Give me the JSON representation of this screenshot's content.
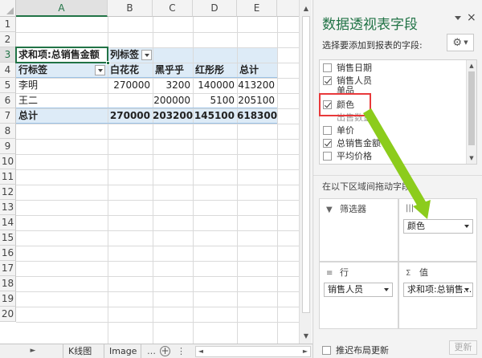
{
  "sheet": {
    "columns": [
      "A",
      "B",
      "C",
      "D",
      "E"
    ],
    "rows": [
      "1",
      "2",
      "3",
      "4",
      "5",
      "6",
      "7",
      "8",
      "9",
      "10",
      "11",
      "12",
      "13",
      "14",
      "15",
      "16",
      "17",
      "18",
      "19",
      "20"
    ],
    "pivot": {
      "value_label": "求和项:总销售金额",
      "col_label": "列标签",
      "row_label": "行标签",
      "col_items": [
        "白花花",
        "黑乎乎",
        "红彤彤",
        "总计"
      ],
      "data_rows": [
        {
          "label": "李明",
          "values": [
            "270000",
            "3200",
            "140000",
            "413200"
          ]
        },
        {
          "label": "王二",
          "values": [
            "",
            "200000",
            "5100",
            "205100"
          ]
        }
      ],
      "total_row": {
        "label": "总计",
        "values": [
          "270000",
          "203200",
          "145100",
          "618300"
        ]
      }
    },
    "tabs": {
      "nav": "►",
      "tab1": "K线图",
      "tab2": "Image",
      "add": "+"
    }
  },
  "pane": {
    "title": "数据透视表字段",
    "close": "×",
    "subtitle": "选择要添加到报表的字段:",
    "fields": [
      {
        "label": "销售日期",
        "checked": false
      },
      {
        "label": "销售人员",
        "checked": true
      },
      {
        "label": "单品",
        "checked": false
      },
      {
        "label": "颜色",
        "checked": true
      },
      {
        "label": "出售数量",
        "checked": false
      },
      {
        "label": "单价",
        "checked": false
      },
      {
        "label": "总销售金额",
        "checked": true
      },
      {
        "label": "平均价格",
        "checked": false
      }
    ],
    "drag_hint": "在以下区域间拖动字段:",
    "areas": {
      "filters": {
        "label": "筛选器"
      },
      "columns": {
        "label": "",
        "field": "颜色"
      },
      "rows": {
        "label": "行",
        "field": "销售人员"
      },
      "values": {
        "label": "值",
        "field": "求和项:总销售..."
      }
    },
    "defer_label": "推迟布局更新",
    "update_label": "更新"
  },
  "colors": {
    "accent": "#217346",
    "pivot_band": "#ddebf7",
    "highlight": "#e8393b",
    "arrow": "#8ccc1c"
  }
}
